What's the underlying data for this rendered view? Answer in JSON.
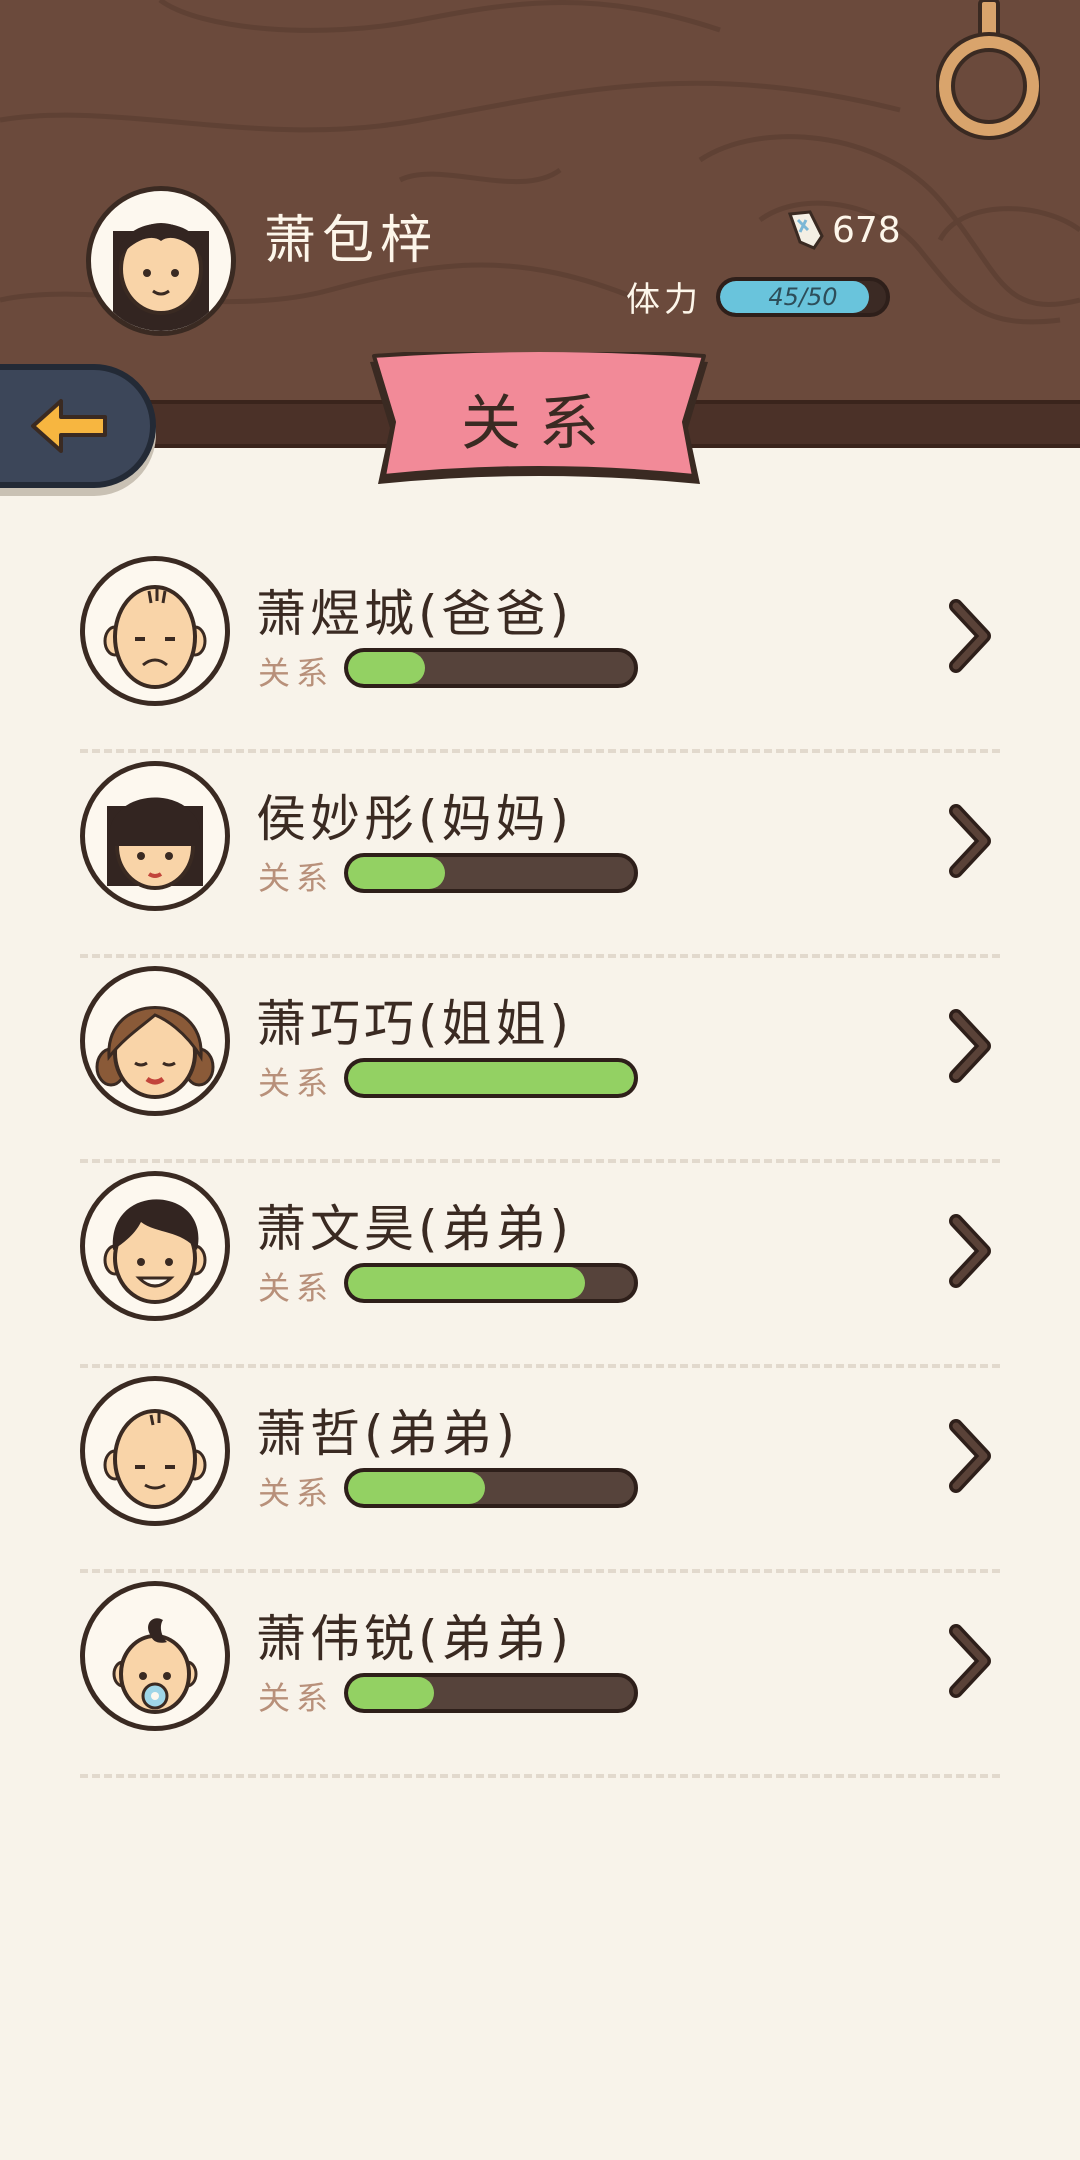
{
  "player": {
    "name": "萧包梓",
    "currency": "678",
    "stamina_label": "体力",
    "stamina_text": "45/50",
    "stamina_value": 45,
    "stamina_max": 50
  },
  "page": {
    "title": "关系"
  },
  "relatives": [
    {
      "name": "萧煜城(爸爸)",
      "rel_label": "关系",
      "relation": 0.27
    },
    {
      "name": "侯妙彤(妈妈)",
      "rel_label": "关系",
      "relation": 0.34
    },
    {
      "name": "萧巧巧(姐姐)",
      "rel_label": "关系",
      "relation": 1.0
    },
    {
      "name": "萧文昊(弟弟)",
      "rel_label": "关系",
      "relation": 0.83
    },
    {
      "name": "萧哲(弟弟)",
      "rel_label": "关系",
      "relation": 0.48
    },
    {
      "name": "萧伟锐(弟弟)",
      "rel_label": "关系",
      "relation": 0.3
    }
  ],
  "colors": {
    "wood": "#6b4a3c",
    "ribbon": "#f28a98",
    "bar_fill": "#93d163",
    "stamina_fill": "#69c4dc",
    "back_button": "#3c4659",
    "back_arrow": "#f7b640"
  },
  "icons": {
    "currency": "paper-ticket-icon",
    "back": "arrow-left-icon",
    "row_arrow": "chevron-right-icon",
    "hook": "hanging-ring-icon"
  }
}
